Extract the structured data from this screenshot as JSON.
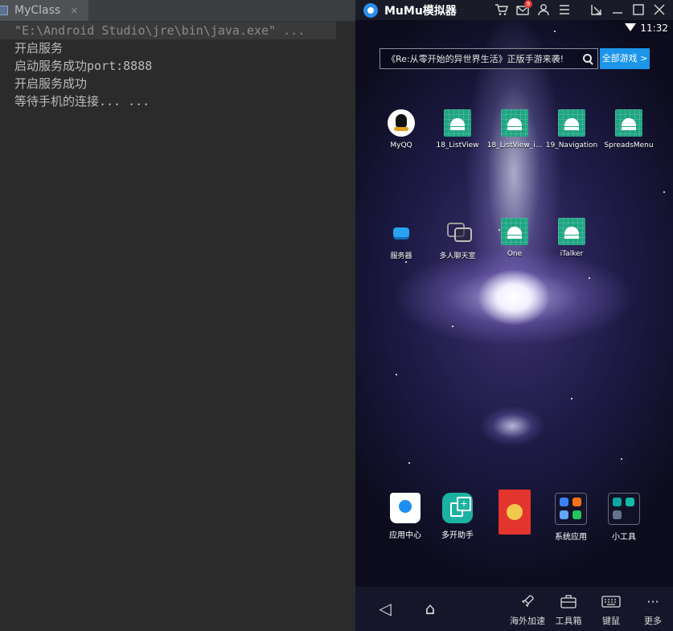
{
  "ide": {
    "tab_label": "MyClass",
    "tab_close": "×",
    "console_lines": [
      "\"E:\\Android Studio\\jre\\bin\\java.exe\" ...",
      "开启服务",
      "启动服务成功port:8888",
      "开启服务成功",
      "等待手机的连接... ..."
    ]
  },
  "emulator": {
    "title": "MuMu模拟器",
    "mail_badge": "9",
    "status_time": "11:32",
    "search_text": "《Re:从零开始的异世界生活》正版手游来袭!",
    "all_games_label": "全部游戏 >",
    "apps": [
      {
        "label": "MyQQ",
        "icon": "qq-icon"
      },
      {
        "label": "18_ListView",
        "icon": "android-icon"
      },
      {
        "label": "18_ListView_i...",
        "icon": "android-icon"
      },
      {
        "label": "19_Navigation",
        "icon": "android-icon"
      },
      {
        "label": "SpreadsMenu",
        "icon": "android-icon"
      },
      {
        "label": "服务器",
        "icon": "server-icon"
      },
      {
        "label": "多人聊天室",
        "icon": "chat-icon"
      },
      {
        "label": "One",
        "icon": "android-icon"
      },
      {
        "label": "iTalker",
        "icon": "android-icon"
      }
    ],
    "dock": [
      {
        "label": "应用中心",
        "icon": "app-store-icon"
      },
      {
        "label": "多开助手",
        "icon": "multi-open-icon"
      },
      {
        "label": "",
        "icon": "red-packet-icon"
      },
      {
        "label": "系统应用",
        "icon": "folder-icon"
      },
      {
        "label": "小工具",
        "icon": "folder-icon"
      }
    ],
    "nav": {
      "back": "◁",
      "home": "⌂",
      "overseas_label": "海外加速",
      "toolbox_label": "工具箱",
      "keyboard_label": "键鼠",
      "more_label": "更多",
      "more_glyph": "···"
    }
  }
}
